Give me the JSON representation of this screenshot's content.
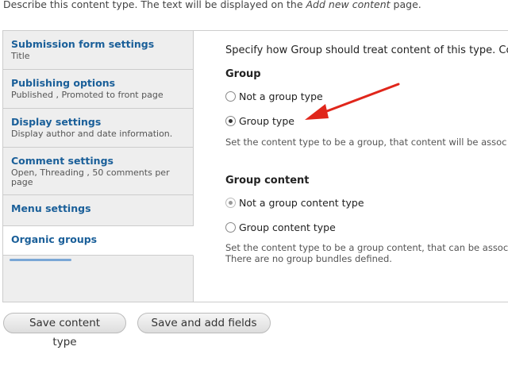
{
  "description": {
    "prefix": "Describe this content type. The text will be displayed on the ",
    "emphasis": "Add new content",
    "suffix": " page."
  },
  "tabs": [
    {
      "title": "Submission form settings",
      "summary": "Title"
    },
    {
      "title": "Publishing options",
      "summary": "Published , Promoted to front page"
    },
    {
      "title": "Display settings",
      "summary": "Display author and date information."
    },
    {
      "title": "Comment settings",
      "summary": "Open, Threading , 50 comments per page"
    },
    {
      "title": "Menu settings",
      "summary": ""
    },
    {
      "title": "Organic groups",
      "summary": "",
      "selected": true
    }
  ],
  "pane": {
    "intro": "Specify how Group should treat content of this type. Con",
    "group": {
      "label": "Group",
      "options": [
        {
          "label": "Not a group type",
          "checked": false
        },
        {
          "label": "Group type",
          "checked": true
        }
      ],
      "help": "Set the content type to be a group, that content will be assoc"
    },
    "group_content": {
      "label": "Group content",
      "options": [
        {
          "label": "Not a group content type",
          "checked": true
        },
        {
          "label": "Group content type",
          "checked": false
        }
      ],
      "help_line1": "Set the content type to be a group content, that can be assoc",
      "help_line2": "There are no group bundles defined."
    }
  },
  "buttons": {
    "save": "Save content type",
    "save_add": "Save and add fields"
  },
  "colors": {
    "link": "#1a5f99",
    "arrow": "#e0261b"
  }
}
